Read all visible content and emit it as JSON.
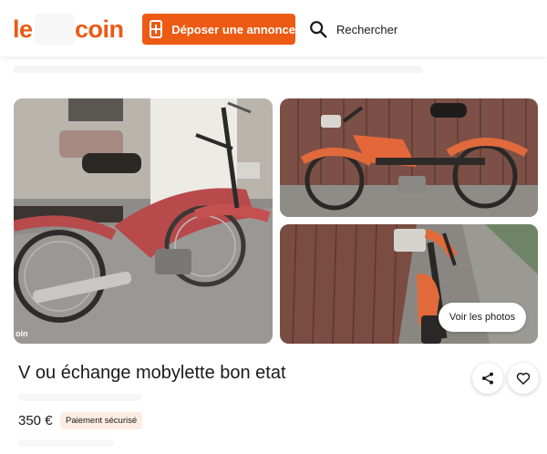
{
  "header": {
    "logo_left": "le",
    "logo_right": "coin",
    "post_button_label": "Déposer une annonce",
    "search_label": "Rechercher"
  },
  "gallery": {
    "watermark": "oin",
    "see_photos_label": "Voir les photos"
  },
  "ad": {
    "title": "V ou échange mobylette bon etat",
    "price": "350 €",
    "payment_badge": "Paiement sécurisé"
  },
  "colors": {
    "brand": "#ec5a13",
    "badge_bg": "#fdece3"
  },
  "icons": [
    "plus-icon",
    "search-icon",
    "share-icon",
    "heart-icon"
  ]
}
